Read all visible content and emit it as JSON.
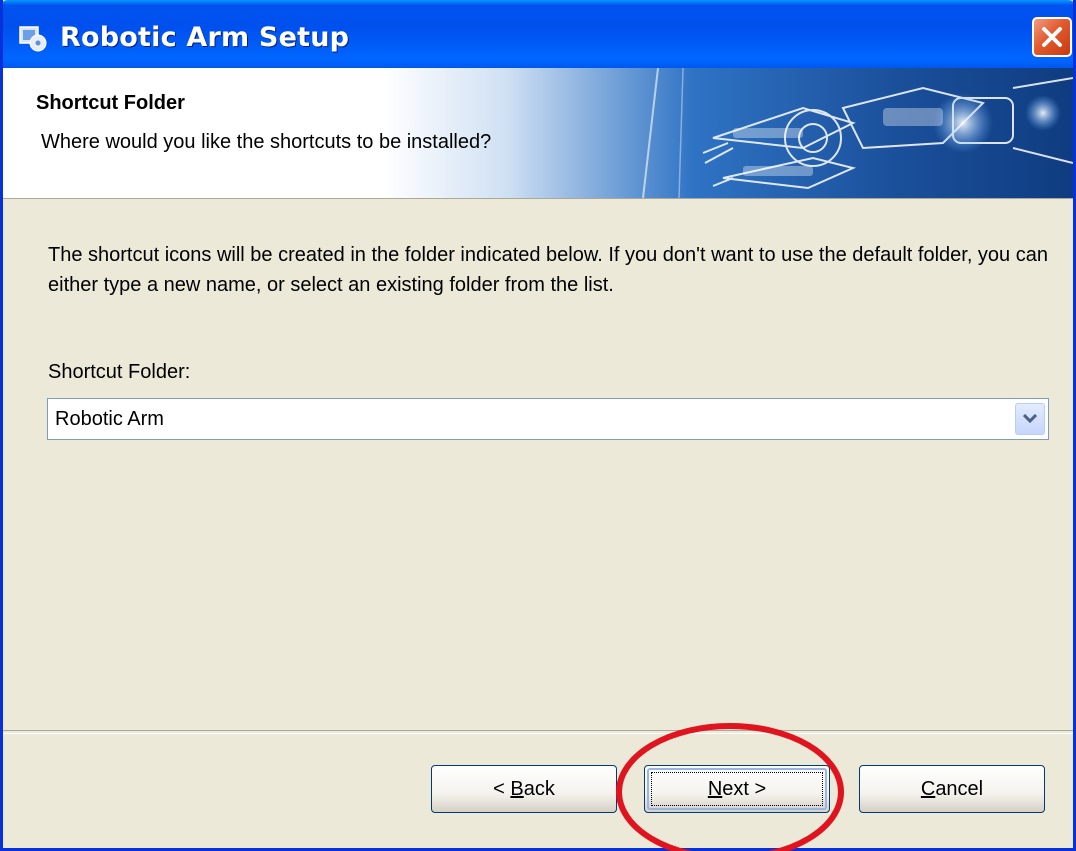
{
  "window": {
    "title": "Robotic Arm Setup"
  },
  "header": {
    "title": "Shortcut Folder",
    "subtitle": "Where would you like the shortcuts to be installed?"
  },
  "main": {
    "description": "The shortcut icons will be created in the folder indicated below. If you don't want to use the default folder, you can either type a new name, or select an existing folder from the list.",
    "field_label": "Shortcut Folder:",
    "folder_value": "Robotic Arm"
  },
  "buttons": {
    "back_prefix": "< ",
    "back_mnemonic": "B",
    "back_rest": "ack",
    "next_mnemonic": "N",
    "next_rest": "ext >",
    "cancel_mnemonic": "C",
    "cancel_rest": "ancel"
  },
  "colors": {
    "titlebar": "#0053ee",
    "dialog_face": "#ece9d8",
    "annotation": "#e0141e"
  },
  "icons": {
    "title": "setup-icon",
    "close": "close-icon",
    "dropdown": "chevron-down-icon"
  }
}
